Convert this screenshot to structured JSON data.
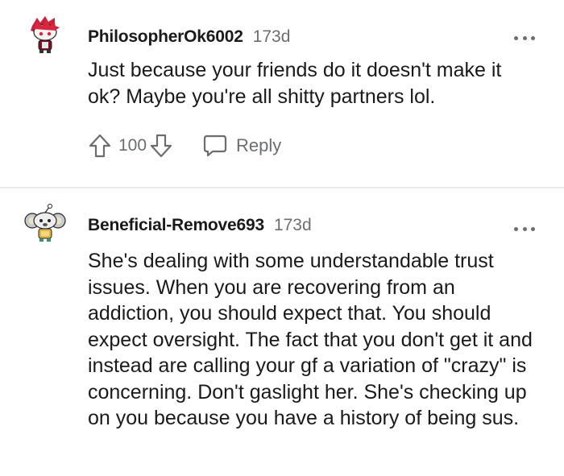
{
  "comments": [
    {
      "username": "PhilosopherOk6002",
      "time": "173d",
      "body": "Just because your friends do it doesn't make it ok? Maybe you're all shitty partners lol.",
      "score": "100",
      "reply_label": "Reply",
      "avatar_icon": "snoo-avatar-red-hair",
      "upvote_icon": "upvote-arrow-icon",
      "downvote_icon": "downvote-arrow-icon",
      "reply_icon": "speech-bubble-icon",
      "more_icon": "more-options-icon"
    },
    {
      "username": "Beneficial-Remove693",
      "time": "173d",
      "body": "She's dealing with some understandable trust issues. When you are recovering from an addiction, you should expect that. You should expect oversight. The fact that you don't get it and instead are calling your gf a variation of \"crazy\" is concerning. Don't gaslight her. She's checking up on you because you have a history of being sus.",
      "avatar_icon": "snoo-avatar-koala-ears",
      "more_icon": "more-options-icon"
    }
  ],
  "colors": {
    "text_primary": "#1a1a1b",
    "text_muted": "#6b6e71",
    "divider": "#e9eaeb"
  }
}
